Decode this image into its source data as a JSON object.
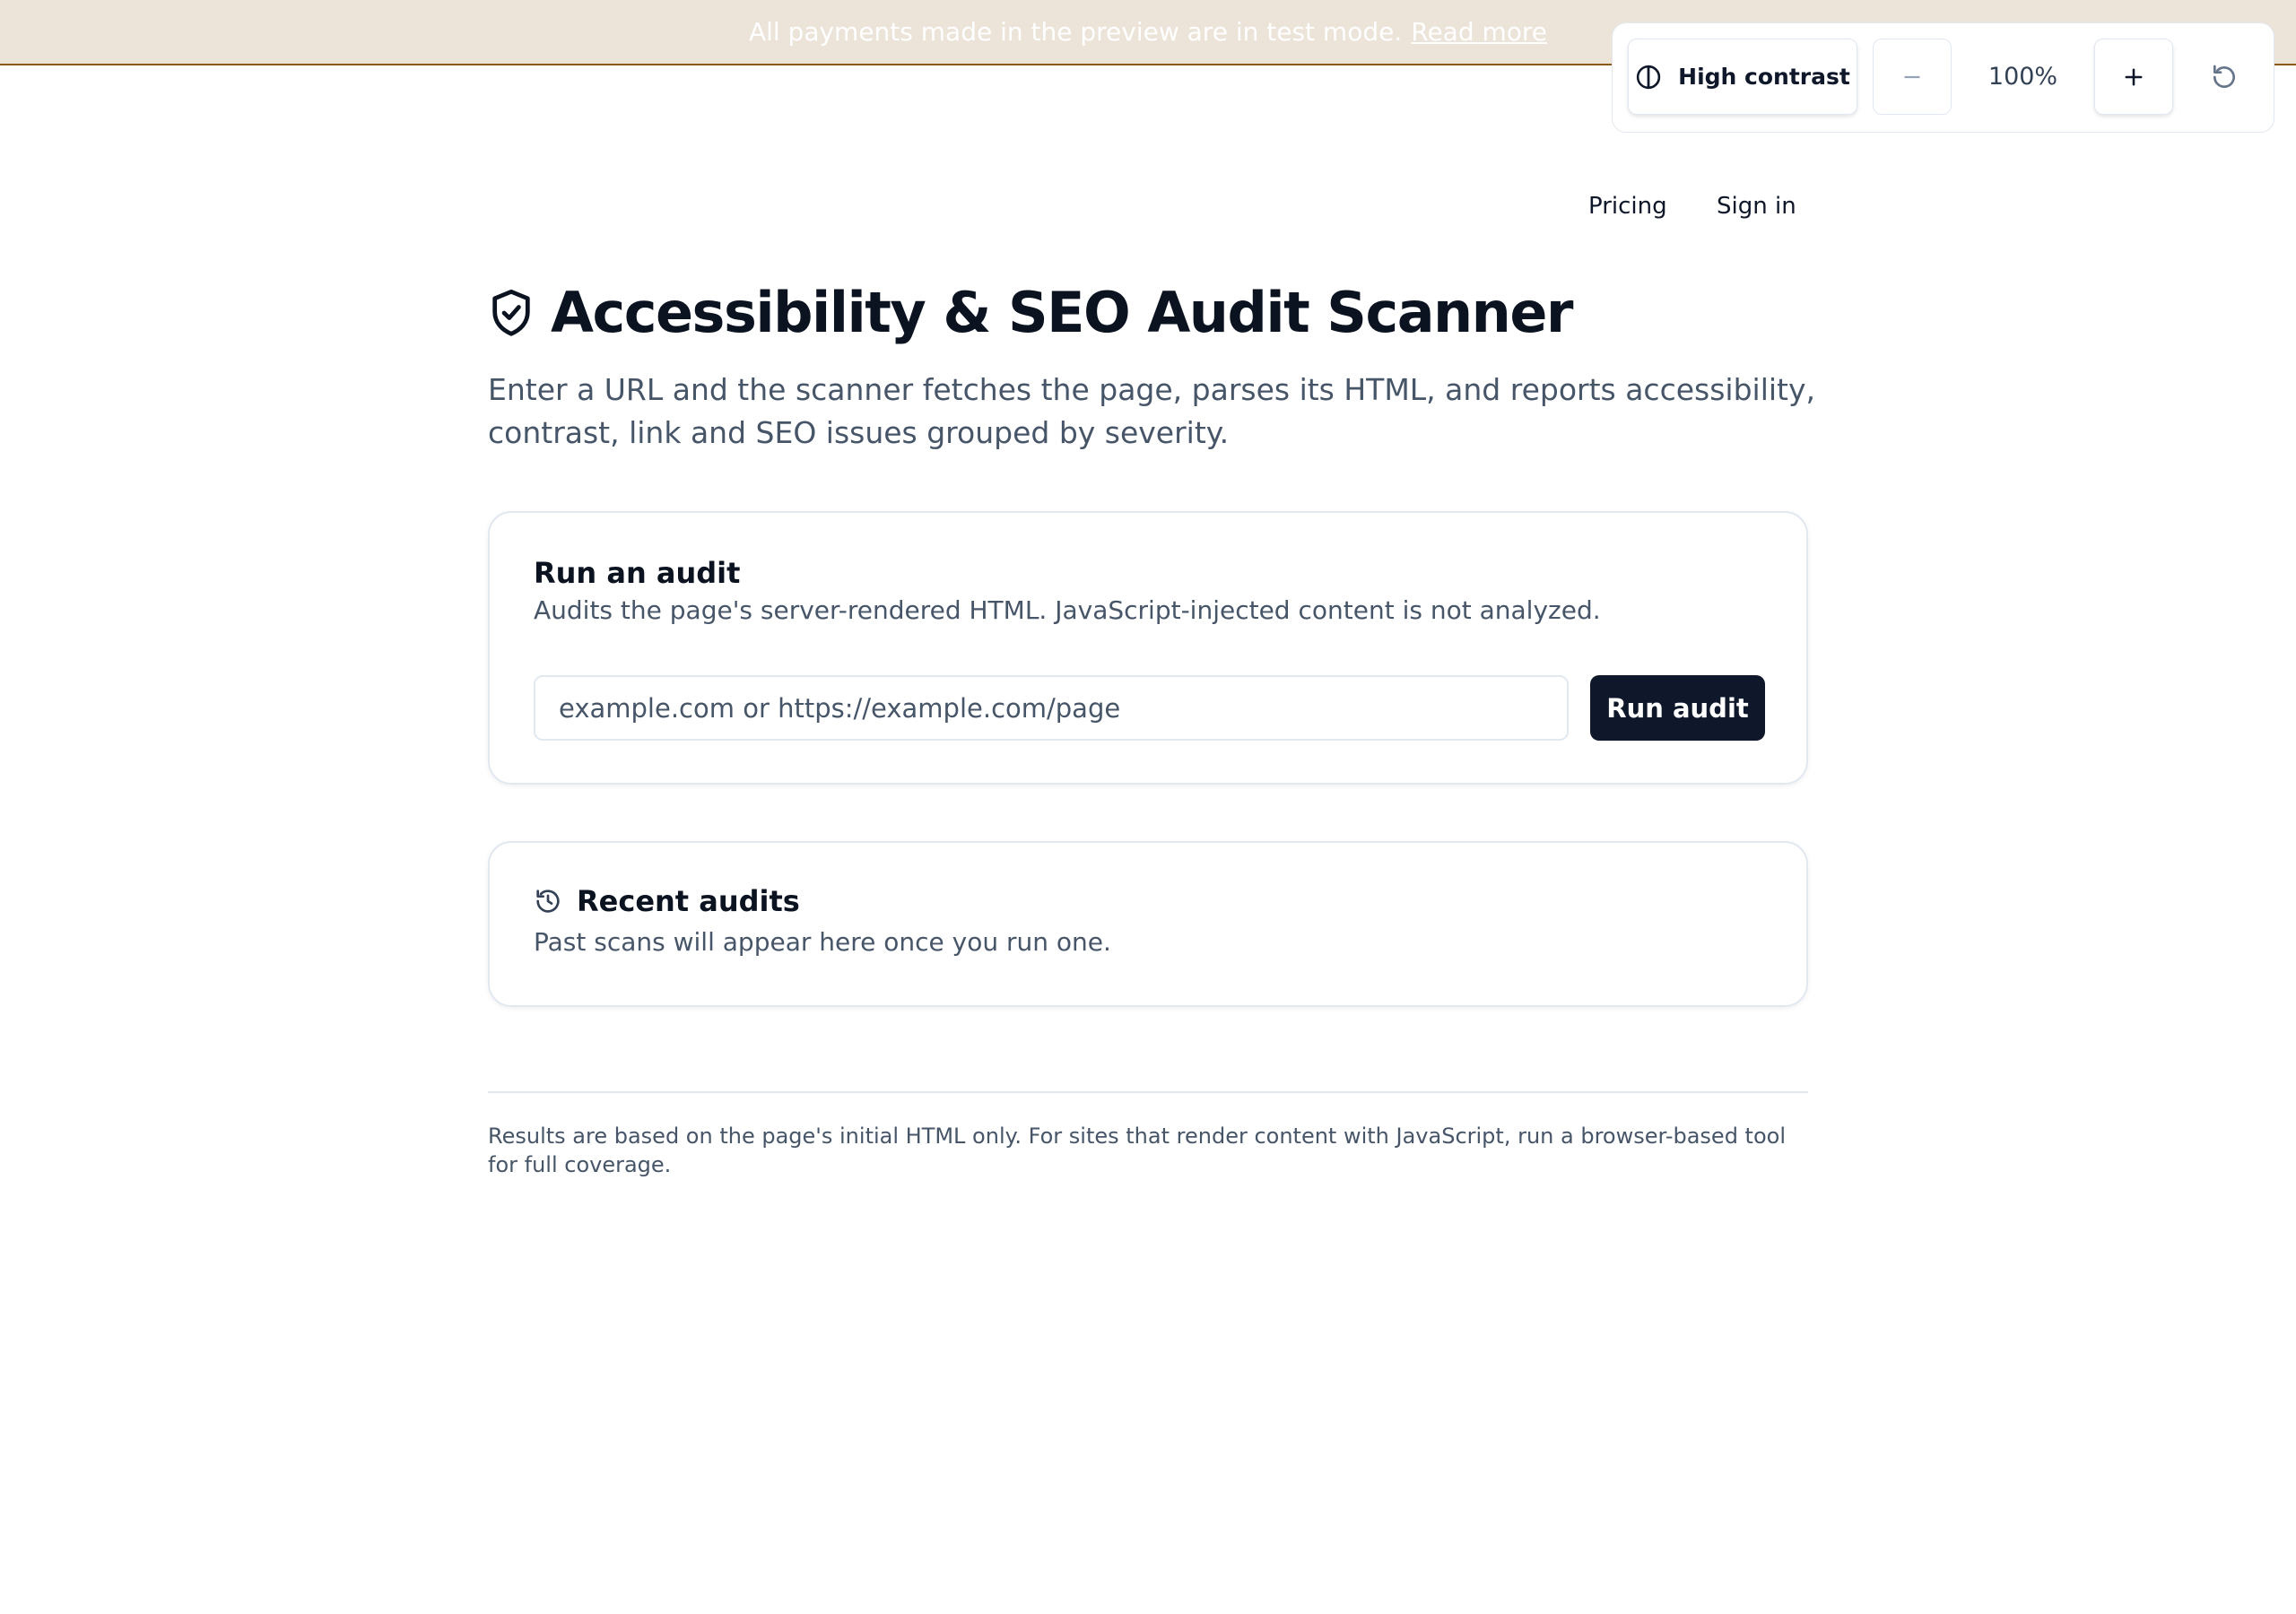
{
  "banner": {
    "text": "All payments made in the preview are in test mode.",
    "link": "Read more"
  },
  "a11y_toolbar": {
    "high_contrast_label": "High contrast",
    "zoom_level": "100%",
    "icons": [
      "contrast-icon",
      "minus-icon",
      "plus-icon",
      "reset-icon"
    ]
  },
  "nav": {
    "pricing": "Pricing",
    "sign_in": "Sign in"
  },
  "header": {
    "title": "Accessibility & SEO Audit Scanner",
    "subtitle": "Enter a URL and the scanner fetches the page, parses its HTML, and reports accessibility, contrast, link and SEO issues grouped by severity.",
    "icon": "shield-check-icon"
  },
  "audit_card": {
    "title": "Run an audit",
    "description": "Audits the page's server-rendered HTML. JavaScript-injected content is not analyzed.",
    "url_input": {
      "value": "",
      "placeholder": "example.com or https://example.com/page"
    },
    "run_button": "Run audit"
  },
  "recent_card": {
    "title": "Recent audits",
    "description": "Past scans will appear here once you run one.",
    "icon": "history-icon"
  },
  "footer": {
    "note": "Results are based on the page's initial HTML only. For sites that render content with JavaScript, run a browser-based tool for full coverage."
  },
  "colors": {
    "banner_bg": "#ece3d9",
    "banner_border": "#8a5a14",
    "primary_button": "#0f172a",
    "muted_text": "#475569",
    "border": "#e2e8f0"
  }
}
